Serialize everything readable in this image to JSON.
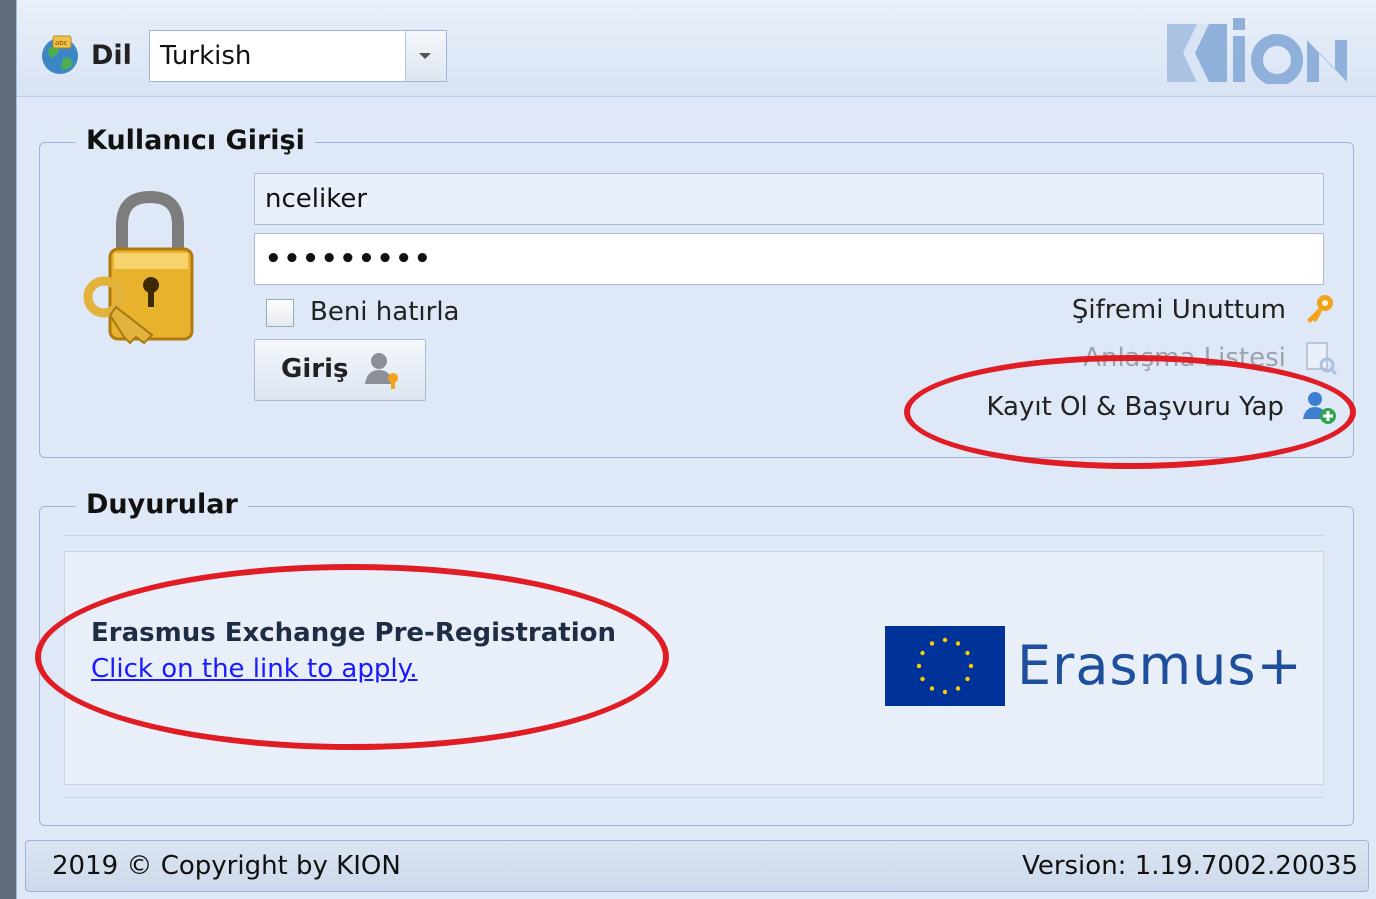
{
  "header": {
    "language_label": "Dil",
    "language_value": "Turkish",
    "logo_text": "KION"
  },
  "login": {
    "legend": "Kullanıcı Girişi",
    "username_value": "nceliker",
    "password_value": "•••••••••",
    "remember_label": "Beni hatırla",
    "login_button": "Giriş",
    "forgot_password": "Şifremi Unuttum",
    "agreement_list": "Anlaşma Listesi",
    "register_apply": "Kayıt Ol & Başvuru Yap"
  },
  "announcements": {
    "legend": "Duyurular",
    "title": "Erasmus Exchange Pre-Registration",
    "link_text": "Click on the link to apply.",
    "erasmus_logo_text": "Erasmus+"
  },
  "footer": {
    "copyright": "2019 © Copyright by KION",
    "version": "Version: 1.19.7002.20035"
  },
  "colors": {
    "annotation_circle": "#e01c24",
    "link": "#1a1aff",
    "eu_blue": "#003399",
    "eu_star": "#ffcc00",
    "erasmus_text": "#1d4f9c"
  }
}
